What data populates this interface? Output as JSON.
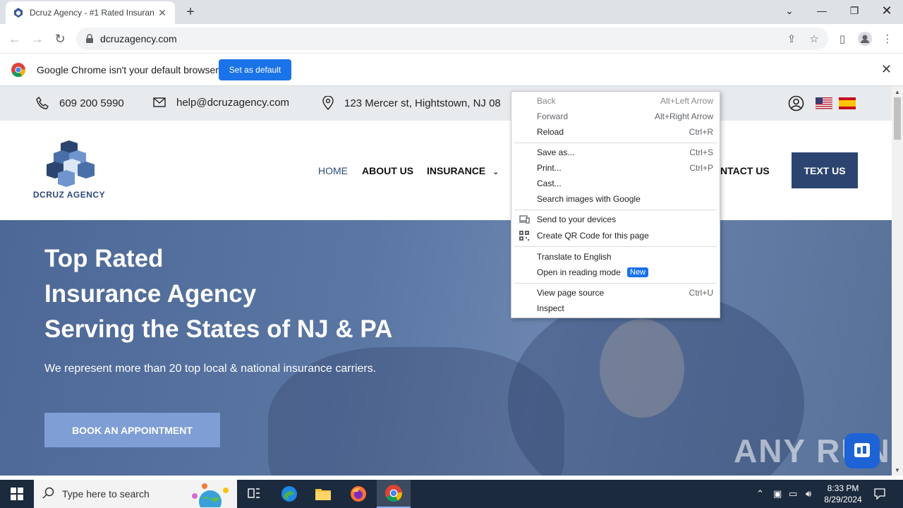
{
  "browser": {
    "tab_title": "Dcruz Agency - #1 Rated Insuran",
    "url": "dcruzagency.com",
    "infobar_message": "Google Chrome isn't your default browser",
    "set_default_label": "Set as default"
  },
  "site": {
    "phone": "609 200 5990",
    "email": "help@dcruzagency.com",
    "address": "123 Mercer st, Hightstown, NJ 08",
    "brand": "DCRUZ AGENCY",
    "nav": {
      "home": "HOME",
      "about": "ABOUT US",
      "insurance": "INSURANCE",
      "contact": "NTACT US",
      "text_us": "TEXT US"
    },
    "hero": {
      "line1": "Top Rated",
      "line2": "Insurance Agency",
      "line3": "Serving the States of NJ & PA",
      "subtitle": "We represent more than 20 top local & national insurance carriers.",
      "cta": "BOOK AN APPOINTMENT"
    },
    "watermark": "ANY RUN"
  },
  "context_menu": {
    "items": [
      {
        "label": "Back",
        "shortcut": "Alt+Left Arrow"
      },
      {
        "label": "Forward",
        "shortcut": "Alt+Right Arrow"
      },
      {
        "label": "Reload",
        "shortcut": "Ctrl+R"
      },
      {
        "label": "Save as...",
        "shortcut": "Ctrl+S"
      },
      {
        "label": "Print...",
        "shortcut": "Ctrl+P"
      },
      {
        "label": "Cast...",
        "shortcut": ""
      },
      {
        "label": "Search images with Google",
        "shortcut": ""
      },
      {
        "label": "Send to your devices",
        "shortcut": ""
      },
      {
        "label": "Create QR Code for this page",
        "shortcut": ""
      },
      {
        "label": "Translate to English",
        "shortcut": ""
      },
      {
        "label": "Open in reading mode",
        "shortcut": "",
        "badge": "New"
      },
      {
        "label": "View page source",
        "shortcut": "Ctrl+U"
      },
      {
        "label": "Inspect",
        "shortcut": ""
      }
    ]
  },
  "taskbar": {
    "search_placeholder": "Type here to search",
    "time": "8:33 PM",
    "date": "8/29/2024"
  },
  "colors": {
    "brand_navy": "#2b4570",
    "chrome_blue": "#1a73e8",
    "hero_blue": "#5a76a3"
  }
}
